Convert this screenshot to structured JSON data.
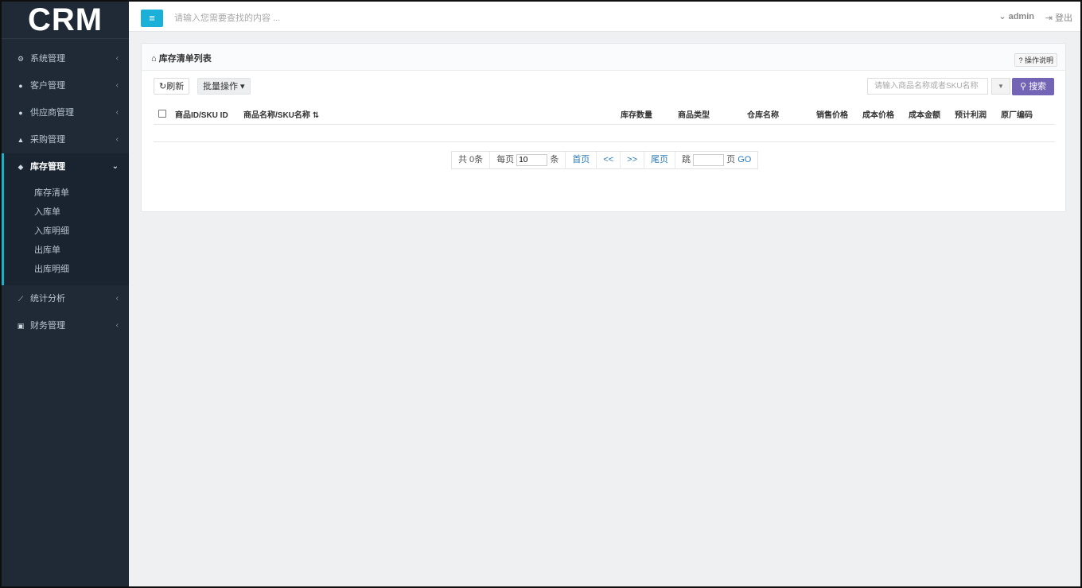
{
  "app": {
    "logo": "CRM"
  },
  "sidebar": {
    "items": [
      {
        "label": "系统管理",
        "icon": "cogs-icon"
      },
      {
        "label": "客户管理",
        "icon": "user-icon"
      },
      {
        "label": "供应商管理",
        "icon": "users-icon"
      },
      {
        "label": "采购管理",
        "icon": "cart-icon"
      },
      {
        "label": "库存管理",
        "icon": "cube-icon",
        "active": true
      },
      {
        "label": "统计分析",
        "icon": "chart-icon"
      },
      {
        "label": "财务管理",
        "icon": "money-icon"
      }
    ],
    "submenu": [
      "库存清单",
      "入库单",
      "入库明细",
      "出库单",
      "出库明细"
    ]
  },
  "header": {
    "menu_icon": "≡",
    "search_placeholder": "请输入您需要查找的内容 ...",
    "user": "admin",
    "logout": "登出"
  },
  "panel": {
    "title": "库存清单列表",
    "help": "操作说明",
    "refresh": "刷新",
    "batch": "批量操作",
    "search_placeholder": "请输入商品名称或者SKU名称",
    "search_button": "搜索",
    "columns": [
      "商品ID/SKU ID",
      "商品名称/SKU名称",
      "库存数量",
      "商品类型",
      "仓库名称",
      "销售价格",
      "成本价格",
      "成本金额",
      "预计利润",
      "原厂编码"
    ]
  },
  "pager": {
    "total": "共 0条",
    "per_page_prefix": "每页",
    "per_page_value": "10",
    "per_page_suffix": "条",
    "first": "首页",
    "prev": "<<",
    "next": ">>",
    "last": "尾页",
    "jump_prefix": "跳",
    "jump_suffix": "页",
    "go": "GO"
  },
  "colors": {
    "sidebar_bg": "#1f2a36",
    "accent": "#1ab0c8",
    "search_btn": "#7464b6",
    "link": "#2a7ab8"
  }
}
